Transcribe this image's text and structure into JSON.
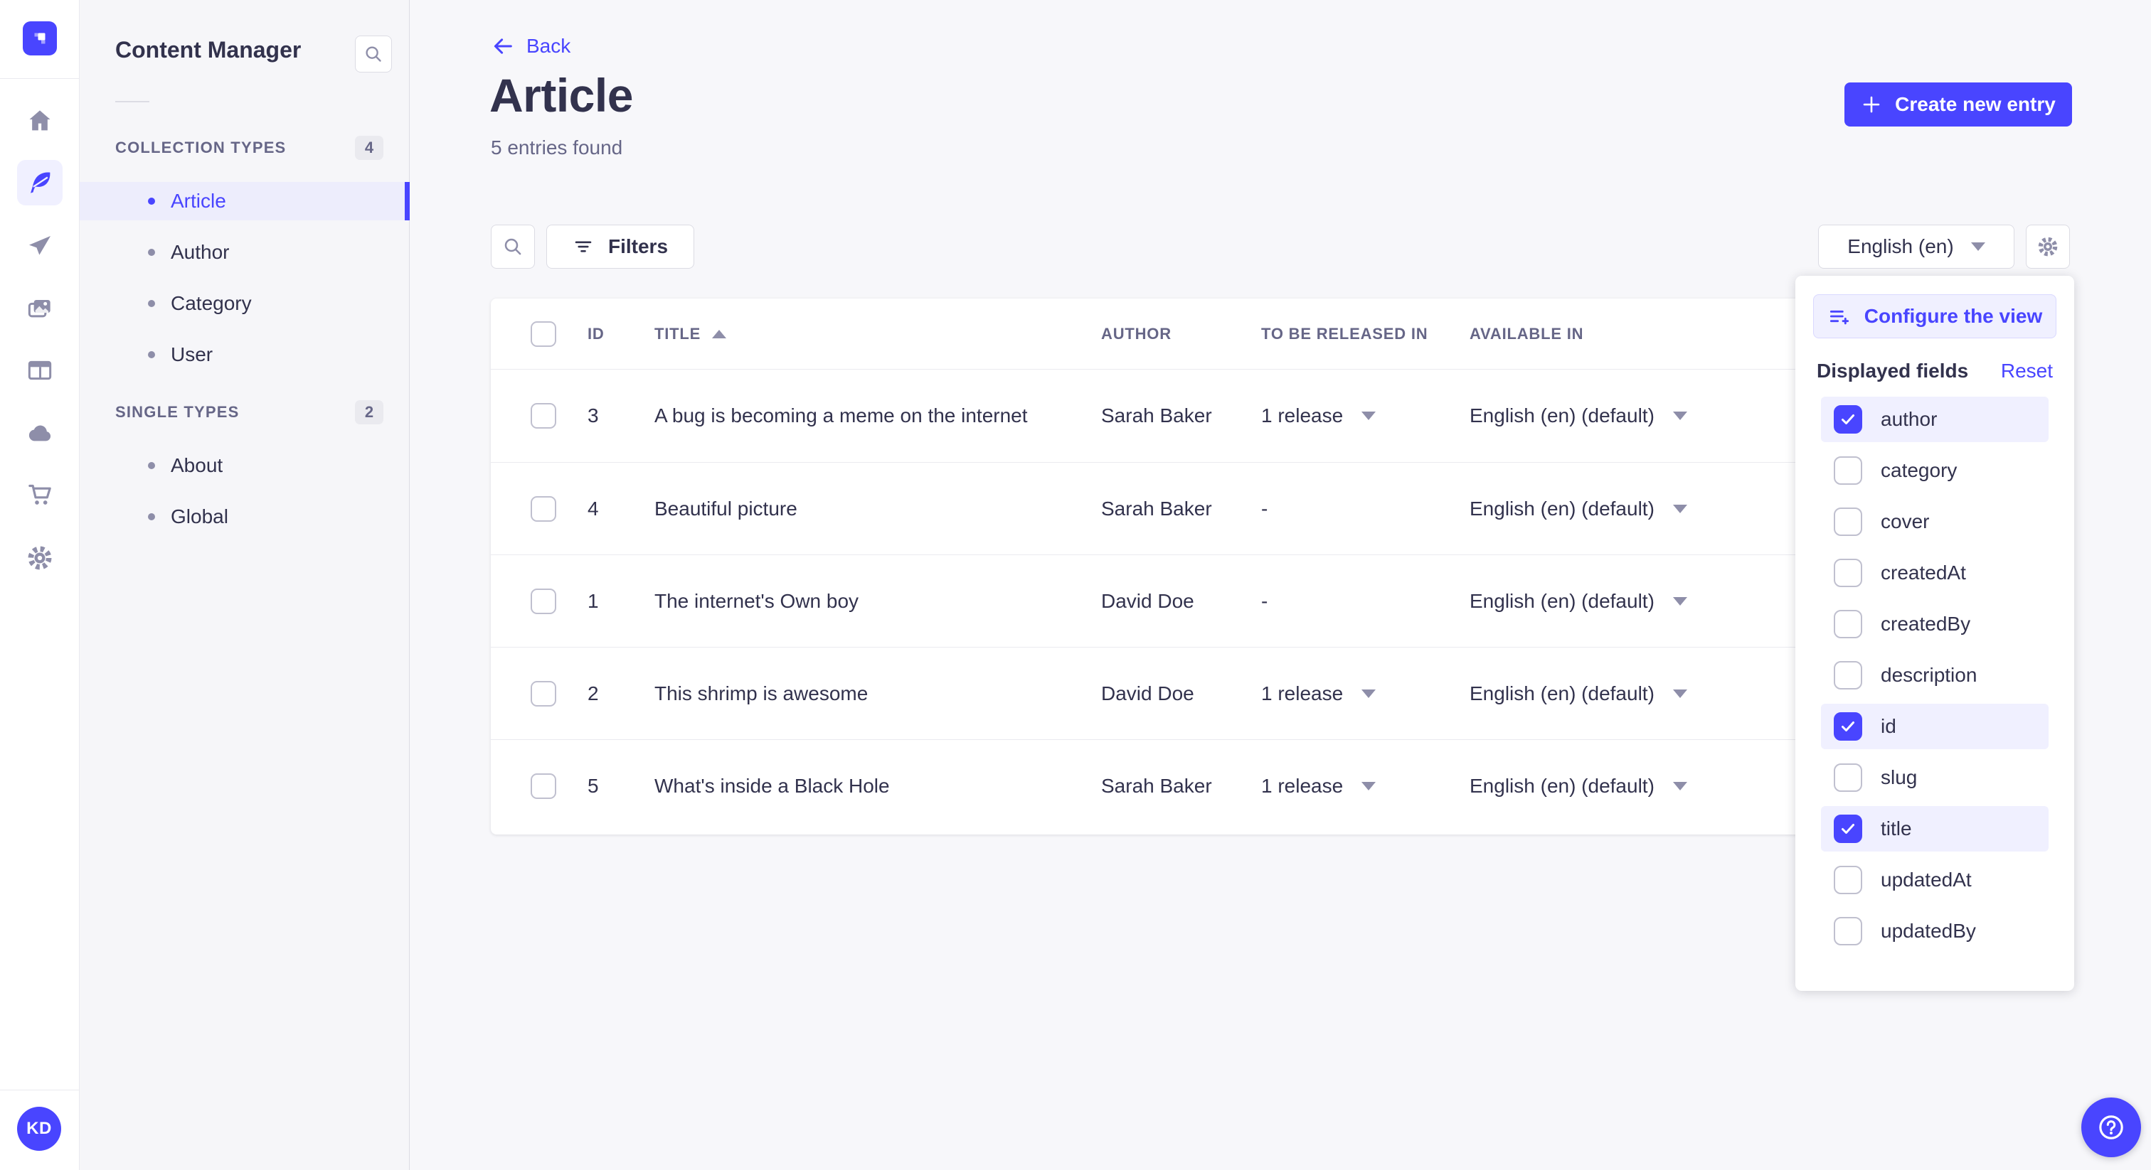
{
  "colors": {
    "accent": "#4945FF",
    "accent_light": "#F0F0FF",
    "accent_border": "#D9D8FF",
    "text_dark": "#32324D",
    "text_gray": "#666687",
    "icon_slate": "#8E8EA9",
    "border": "#DCDCE4",
    "row_line": "#EAEAEF",
    "page_bg": "#F6F6F9"
  },
  "nav": {
    "icons": [
      "home",
      "content-manager",
      "releases",
      "media-library",
      "content-type-builder",
      "deploy",
      "marketplace",
      "settings"
    ],
    "active_icon": "content-manager",
    "avatar_initials": "KD"
  },
  "subnav": {
    "title": "Content Manager",
    "sections": [
      {
        "label": "COLLECTION TYPES",
        "count": "4",
        "items": [
          {
            "label": "Article",
            "active": true
          },
          {
            "label": "Author",
            "active": false
          },
          {
            "label": "Category",
            "active": false
          },
          {
            "label": "User",
            "active": false
          }
        ]
      },
      {
        "label": "SINGLE TYPES",
        "count": "2",
        "items": [
          {
            "label": "About",
            "active": false
          },
          {
            "label": "Global",
            "active": false
          }
        ]
      }
    ]
  },
  "header": {
    "back_label": "Back",
    "title": "Article",
    "subtitle": "5 entries found",
    "create_button_label": "Create new entry"
  },
  "toolbar": {
    "filters_label": "Filters",
    "locale_value": "English (en)"
  },
  "table": {
    "columns": [
      "ID",
      "TITLE",
      "AUTHOR",
      "TO BE RELEASED IN",
      "AVAILABLE IN"
    ],
    "sorted_column": "TITLE",
    "sort_direction": "asc",
    "rows": [
      {
        "id": "3",
        "title": "A bug is becoming a meme on the internet",
        "author": "Sarah Baker",
        "release": "1 release",
        "available": "English (en) (default)"
      },
      {
        "id": "4",
        "title": "Beautiful picture",
        "author": "Sarah Baker",
        "release": "-",
        "available": "English (en) (default)"
      },
      {
        "id": "1",
        "title": "The internet's Own boy",
        "author": "David Doe",
        "release": "-",
        "available": "English (en) (default)"
      },
      {
        "id": "2",
        "title": "This shrimp is awesome",
        "author": "David Doe",
        "release": "1 release",
        "available": "English (en) (default)"
      },
      {
        "id": "5",
        "title": "What's inside a Black Hole",
        "author": "Sarah Baker",
        "release": "1 release",
        "available": "English (en) (default)"
      }
    ]
  },
  "popover": {
    "configure_button_label": "Configure the view",
    "displayed_fields_label": "Displayed fields",
    "reset_label": "Reset",
    "fields": [
      {
        "label": "author",
        "checked": true
      },
      {
        "label": "category",
        "checked": false
      },
      {
        "label": "cover",
        "checked": false
      },
      {
        "label": "createdAt",
        "checked": false
      },
      {
        "label": "createdBy",
        "checked": false
      },
      {
        "label": "description",
        "checked": false
      },
      {
        "label": "id",
        "checked": true
      },
      {
        "label": "slug",
        "checked": false
      },
      {
        "label": "title",
        "checked": true
      },
      {
        "label": "updatedAt",
        "checked": false
      },
      {
        "label": "updatedBy",
        "checked": false
      }
    ]
  }
}
